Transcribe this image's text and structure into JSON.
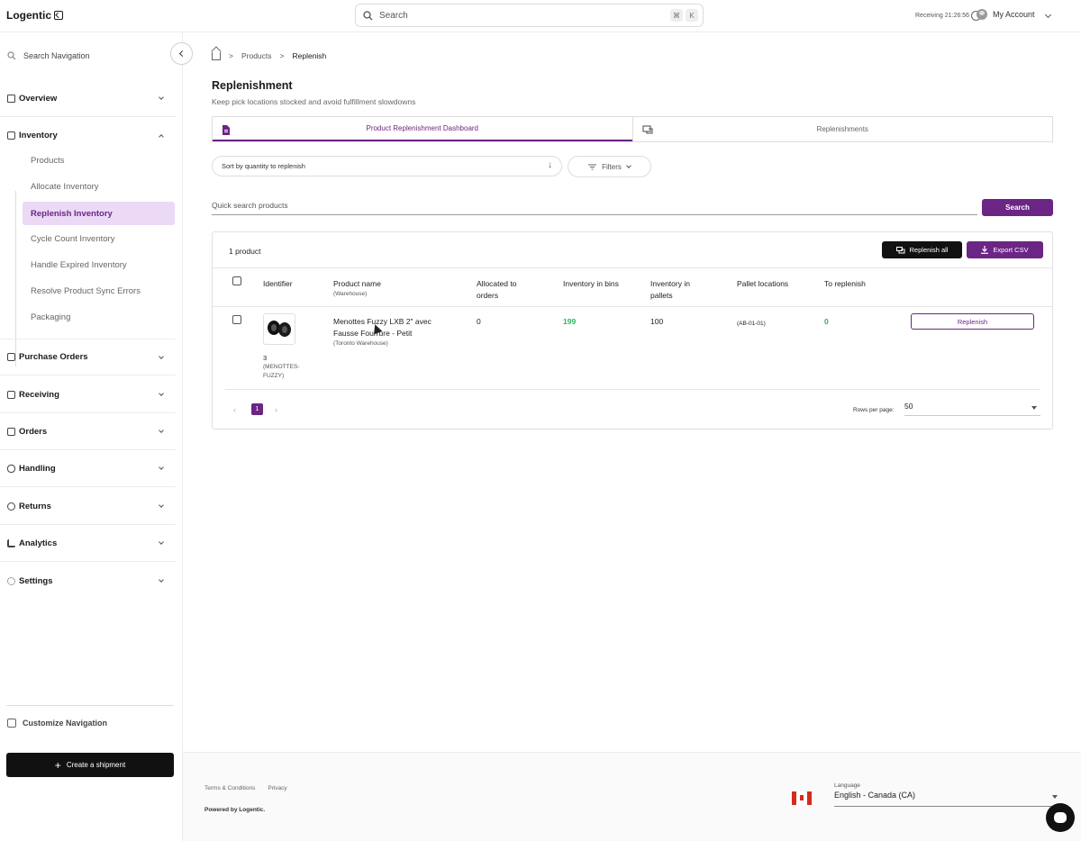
{
  "app": {
    "logo": "Logentic"
  },
  "topbar": {
    "search_placeholder": "Search",
    "kbd_cmd": "⌘",
    "kbd_k": "K",
    "receiving_label": "Receiving",
    "receiving_time": "21:26:56",
    "account_label": "My Account"
  },
  "sidebar": {
    "search_placeholder": "Search Navigation",
    "sections": {
      "overview": "Overview",
      "inventory": "Inventory",
      "purchase_orders": "Purchase Orders",
      "receiving": "Receiving",
      "orders": "Orders",
      "handling": "Handling",
      "returns": "Returns",
      "analytics": "Analytics",
      "settings": "Settings"
    },
    "inventory_items": [
      "Products",
      "Allocate Inventory",
      "Replenish Inventory",
      "Cycle Count Inventory",
      "Handle Expired Inventory",
      "Resolve Product Sync Errors",
      "Packaging"
    ],
    "customize_label": "Customize Navigation",
    "create_shipment": "Create a shipment"
  },
  "breadcrumb": {
    "products": "Products",
    "current": "Replenish"
  },
  "page": {
    "title": "Replenishment",
    "subtitle": "Keep pick locations stocked and avoid fulfillment slowdowns",
    "tabs": [
      "Product Replenishment Dashboard",
      "Replenishments"
    ],
    "sort_label": "Sort by quantity to replenish",
    "filters_label": "Filters",
    "quick_search_placeholder": "Quick search products",
    "search_button": "Search"
  },
  "table": {
    "count_label": "1 product",
    "replenish_all": "Replenish all",
    "export_csv": "Export CSV",
    "headers": {
      "identifier": "Identifier",
      "product_name": "Product name",
      "product_name_sub": "(Warehouse)",
      "allocated": "Allocated to orders",
      "inventory_bins": "Inventory in bins",
      "inventory_pallets": "Inventory in pallets",
      "pallet_locations": "Pallet locations",
      "to_replenish": "To replenish"
    },
    "rows": [
      {
        "identifier": "3",
        "identifier_sub": "(MENOTTES-FUZZY)",
        "name": "Menottes Fuzzy LXB 2\" avec Fausse Fourrure - Petit",
        "warehouse": "(Toronto Warehouse)",
        "allocated": "0",
        "bins": "199",
        "pallets": "100",
        "pallet_locations": "(AB-01-01)",
        "to_replenish": "0",
        "action": "Replenish"
      }
    ],
    "pagination": {
      "prev": "‹",
      "page": "1",
      "next": "›"
    },
    "rows_per_page_label": "Rows per page:",
    "rows_per_page_value": "50"
  },
  "footer": {
    "terms": "Terms & Conditions",
    "privacy": "Privacy",
    "powered_by": "Powered by Logentic.",
    "language_label": "Language",
    "language_value": "English - Canada (CA)"
  },
  "colors": {
    "accent": "#6b2585",
    "active_bg": "#ebd9f6",
    "positive": "#2db55d"
  }
}
